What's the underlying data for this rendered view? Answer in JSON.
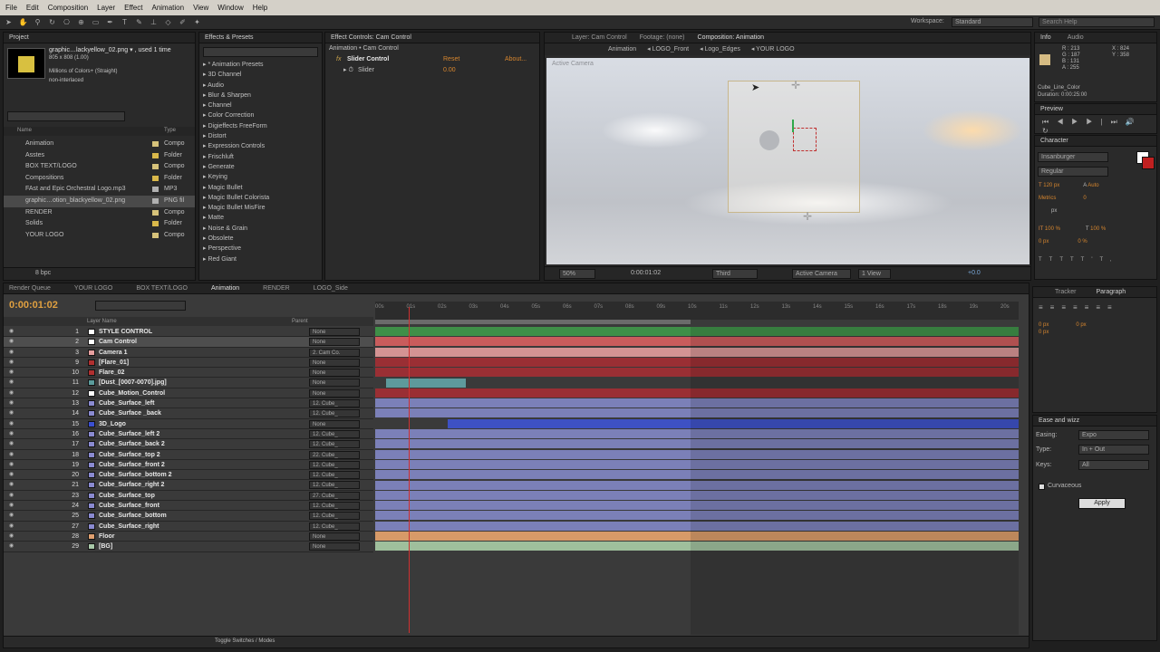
{
  "menu": [
    "File",
    "Edit",
    "Composition",
    "Layer",
    "Effect",
    "Animation",
    "View",
    "Window",
    "Help"
  ],
  "workspace": {
    "label": "Workspace:",
    "value": "Standard",
    "search_placeholder": "Search Help"
  },
  "project": {
    "tab": "Project",
    "file_name": "graphic…lackyellow_02.png ▾ , used 1 time",
    "file_dims": "805 x 808 (1.00)",
    "file_colors": "Millions of Colors+ (Straight)",
    "file_interlace": "non-interlaced",
    "col_name": "Name",
    "col_type": "Type",
    "bpc": "8 bpc",
    "items": [
      {
        "name": "Animation",
        "type": "Compo",
        "color": "#d6c27a"
      },
      {
        "name": "Asstes",
        "type": "Folder",
        "color": "#d9b84a"
      },
      {
        "name": "BOX TEXT/LOGO",
        "type": "Compo",
        "color": "#d6c27a"
      },
      {
        "name": "Compositions",
        "type": "Folder",
        "color": "#d9b84a"
      },
      {
        "name": "FAst and Epic Orchestral Logo.mp3",
        "type": "MP3",
        "color": "#b0b0b0"
      },
      {
        "name": "graphic…otion_blackyellow_02.png",
        "type": "PNG fil",
        "color": "#b0b0b0"
      },
      {
        "name": "RENDER",
        "type": "Compo",
        "color": "#d6c27a"
      },
      {
        "name": "Solids",
        "type": "Folder",
        "color": "#d9b84a"
      },
      {
        "name": "YOUR LOGO",
        "type": "Compo",
        "color": "#d6c27a"
      }
    ]
  },
  "effects": {
    "tab": "Effects & Presets",
    "items": [
      "* Animation Presets",
      "3D Channel",
      "Audio",
      "Blur & Sharpen",
      "Channel",
      "Color Correction",
      "Digieffects FreeForm",
      "Distort",
      "Expression Controls",
      "Frischluft",
      "Generate",
      "Keying",
      "Magic Bullet",
      "Magic Bullet Colorista",
      "Magic Bullet MisFire",
      "Matte",
      "Noise & Grain",
      "Obsolete",
      "Perspective",
      "Red Giant"
    ]
  },
  "effect_controls": {
    "tab": "Effect Controls: Cam Control",
    "crumb": "Animation • Cam Control",
    "effect": "Slider Control",
    "reset": "Reset",
    "about": "About...",
    "param": "Slider",
    "param_value": "0.00"
  },
  "viewer": {
    "tabs": [
      "Layer: Cam Control",
      "Footage: (none)",
      "Composition: Animation"
    ],
    "flow": [
      "Animation",
      "LOGO_Front",
      "Logo_Edges",
      "YOUR LOGO"
    ],
    "camera_label": "Active Camera",
    "zoom": "50%",
    "time": "0:00:01:02",
    "res": "Third",
    "view": "Active Camera",
    "views": "1 View",
    "exposure": "+0.0"
  },
  "info": {
    "tabs": [
      "Info",
      "Audio"
    ],
    "r": "R : 213",
    "g": "G : 187",
    "b": "B : 131",
    "a": "A : 255",
    "x": "X : 824",
    "y": "Y : 358",
    "layer": "Cube_Line_Color",
    "duration": "Duration: 0:00:25:00",
    "swatch": "#d5bb83"
  },
  "preview": {
    "tab": "Preview"
  },
  "character": {
    "tab": "Character",
    "font": "Insanburger",
    "style": "Regular",
    "size": "120 px",
    "leading": "Auto",
    "tracking": "Metrics",
    "kern": "0",
    "unit": "px",
    "scale_v": "100 %",
    "scale_h": "100 %",
    "baseline": "0 px",
    "tsume": "0 %"
  },
  "tracker_tabs": [
    "Tracker",
    "Paragraph"
  ],
  "paragraph": {
    "indent1": "0 px",
    "indent2": "0 px",
    "indent3": "0 px"
  },
  "ease": {
    "tab": "Ease and wizz",
    "easing_label": "Easing:",
    "easing": "Expo",
    "type_label": "Type:",
    "type": "In + Out",
    "keys_label": "Keys:",
    "keys": "All",
    "curvaceous": "Curvaceous",
    "apply": "Apply"
  },
  "timeline": {
    "tabs": [
      "Render Queue",
      "YOUR LOGO",
      "BOX TEXT/LOGO",
      "Animation",
      "RENDER",
      "LOGO_Side"
    ],
    "active_tab": "Animation",
    "time": "0:00:01:02",
    "col_layer": "Layer Name",
    "col_parent": "Parent",
    "ruler": [
      "00s",
      "01s",
      "02s",
      "03s",
      "04s",
      "05s",
      "06s",
      "07s",
      "08s",
      "09s",
      "10s",
      "11s",
      "12s",
      "13s",
      "14s",
      "15s",
      "16s",
      "17s",
      "18s",
      "19s",
      "20s"
    ],
    "footer": "Toggle Switches / Modes",
    "layers": [
      {
        "num": "1",
        "name": "STYLE CONTROL",
        "parent": "None",
        "sw": "#ffffff",
        "bar": "#3f8f48"
      },
      {
        "num": "2",
        "name": "Cam Control",
        "parent": "None",
        "sw": "#ffffff",
        "bar": "#c95c5c",
        "sel": true
      },
      {
        "num": "3",
        "name": "Camera 1",
        "parent": "2. Cam Co.",
        "sw": "#e6a0a0",
        "bar": "#d49393"
      },
      {
        "num": "9",
        "name": "[Flare_01]",
        "parent": "None",
        "sw": "#b03030",
        "bar": "#9a2f34"
      },
      {
        "num": "10",
        "name": "Flare_02",
        "parent": "None",
        "sw": "#b03030",
        "bar": "#9a2f34"
      },
      {
        "num": "11",
        "name": "[Dust_[0007-0070].jpg]",
        "parent": "None",
        "sw": "#5b9b9b",
        "bar": "#5e9a9c"
      },
      {
        "num": "12",
        "name": "Cube_Motion_Control",
        "parent": "None",
        "sw": "#ffffff",
        "bar": "#9a2f34"
      },
      {
        "num": "13",
        "name": "Cube_Surface_left",
        "parent": "12. Cube_",
        "sw": "#8a8ad0",
        "bar": "#7b80b8"
      },
      {
        "num": "14",
        "name": "Cube_Surface _back",
        "parent": "12. Cube_",
        "sw": "#8a8ad0",
        "bar": "#7b80b8"
      },
      {
        "num": "15",
        "name": "3D_Logo",
        "parent": "None",
        "sw": "#3b4fd0",
        "bar": "#3e51c4"
      },
      {
        "num": "16",
        "name": "Cube_Surface_left 2",
        "parent": "12. Cube_",
        "sw": "#8a8ad0",
        "bar": "#7b80b8"
      },
      {
        "num": "17",
        "name": "Cube_Surface_back 2",
        "parent": "12. Cube_",
        "sw": "#8a8ad0",
        "bar": "#7b80b8"
      },
      {
        "num": "18",
        "name": "Cube_Surface_top 2",
        "parent": "22. Cube_",
        "sw": "#8a8ad0",
        "bar": "#7b80b8"
      },
      {
        "num": "19",
        "name": "Cube_Surface_front 2",
        "parent": "12. Cube_",
        "sw": "#8a8ad0",
        "bar": "#7b80b8"
      },
      {
        "num": "20",
        "name": "Cube_Surface_bottom 2",
        "parent": "12. Cube_",
        "sw": "#8a8ad0",
        "bar": "#7b80b8"
      },
      {
        "num": "21",
        "name": "Cube_Surface_right 2",
        "parent": "12. Cube_",
        "sw": "#8a8ad0",
        "bar": "#7b80b8"
      },
      {
        "num": "23",
        "name": "Cube_Surface_top",
        "parent": "27. Cube_",
        "sw": "#8a8ad0",
        "bar": "#7b80b8"
      },
      {
        "num": "24",
        "name": "Cube_Surface_front",
        "parent": "12. Cube_",
        "sw": "#8a8ad0",
        "bar": "#7b80b8"
      },
      {
        "num": "25",
        "name": "Cube_Surface_bottom",
        "parent": "12. Cube_",
        "sw": "#8a8ad0",
        "bar": "#7b80b8"
      },
      {
        "num": "27",
        "name": "Cube_Surface_right",
        "parent": "12. Cube_",
        "sw": "#8a8ad0",
        "bar": "#7b80b8"
      },
      {
        "num": "28",
        "name": "Floor",
        "parent": "None",
        "sw": "#e0a070",
        "bar": "#d79a68"
      },
      {
        "num": "29",
        "name": "[BG]",
        "parent": "None",
        "sw": "#a8c8a8",
        "bar": "#9fbf9c"
      }
    ]
  }
}
